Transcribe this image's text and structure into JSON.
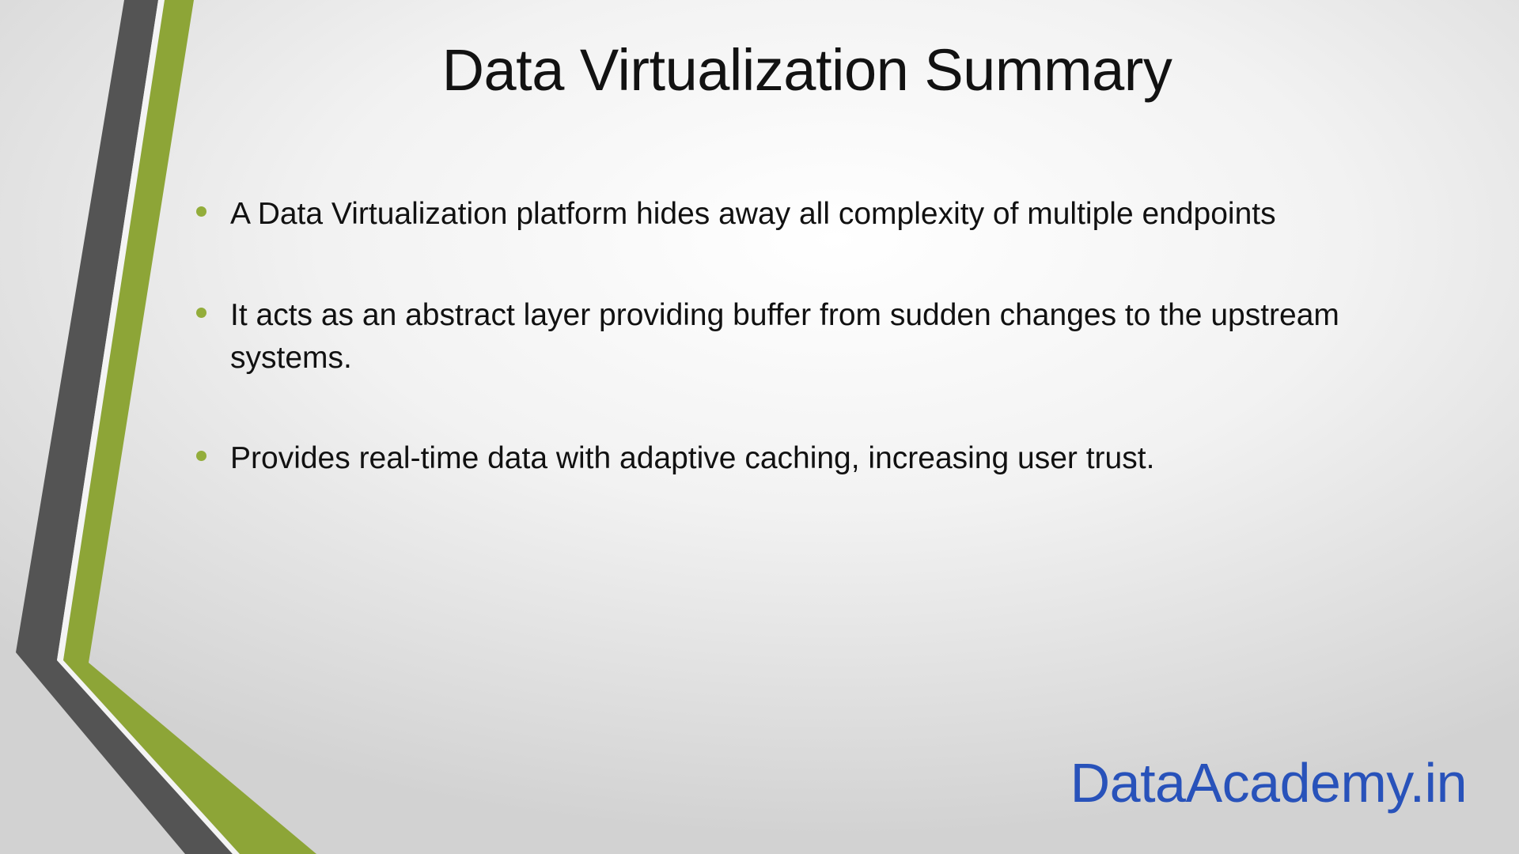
{
  "slide": {
    "title": "Data Virtualization Summary",
    "bullets": [
      {
        "text": "A Data Virtualization platform hides away all complexity of multiple endpoints"
      },
      {
        "text": "It acts as an abstract layer providing buffer from sudden changes to the upstream systems."
      },
      {
        "text": "Provides real-time data with adaptive caching, increasing user trust."
      }
    ],
    "brand": "DataAcademy.in"
  },
  "colors": {
    "accent_green": "#93ad3b",
    "stripe_gray": "#555555",
    "brand_blue": "#2852ba",
    "text": "#111111"
  }
}
